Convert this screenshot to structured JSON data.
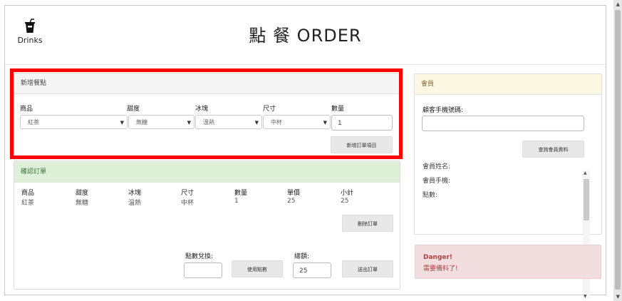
{
  "header": {
    "logo_label": "Drinks",
    "title": "點 餐 ORDER"
  },
  "add_item": {
    "heading": "新增餐點",
    "labels": {
      "product": "商品",
      "sweetness": "甜度",
      "ice": "冰塊",
      "size": "尺寸",
      "quantity": "數量"
    },
    "product_value": "紅茶",
    "sweetness_value": "無糖",
    "ice_value": "溫熱",
    "size_value": "中杯",
    "quantity_value": "1",
    "add_button": "新增訂單項目"
  },
  "confirm": {
    "heading": "確認訂單",
    "columns": [
      "商品",
      "甜度",
      "冰塊",
      "尺寸",
      "數量",
      "單價",
      "小計"
    ],
    "row": [
      "紅茶",
      "無糖",
      "溫熱",
      "中杯",
      "1",
      "25",
      "25"
    ],
    "delete_button": "刪除訂單",
    "points_label": "點數兌換:",
    "points_value": "",
    "use_points_button": "使用點數",
    "total_label": "總額:",
    "total_value": "25",
    "checkout_button": "送出訂單"
  },
  "member": {
    "heading": "會員",
    "phone_label": "顧客手機號碼:",
    "phone_value": "",
    "query_button": "查詢會員資料",
    "name_label": "會員姓名:",
    "mobile_label": "會員手機:",
    "points_label": "點數:"
  },
  "alert": {
    "title": "Danger!",
    "message": "需要備料了!"
  },
  "colors": {
    "member_header": "#fcf8e3",
    "confirm_header": "#dff0d8",
    "alert_bg": "#f2dede",
    "alert_text": "#a94442",
    "highlight": "#ff0000"
  }
}
